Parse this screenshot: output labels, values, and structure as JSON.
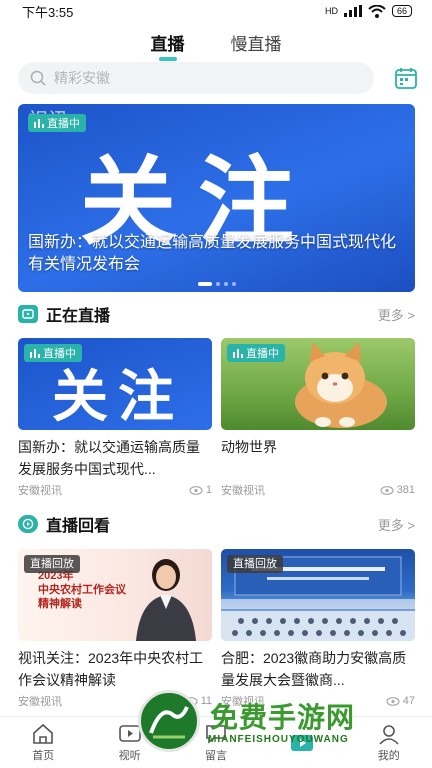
{
  "status": {
    "time": "下午3:55",
    "network": "HD",
    "battery": "66"
  },
  "tabs": [
    {
      "label": "直播"
    },
    {
      "label": "慢直播"
    }
  ],
  "search": {
    "placeholder": "精彩安徽"
  },
  "banner": {
    "big_text": "关注",
    "tag": "视讯",
    "badge": "直播中",
    "caption": "国新办：就以交通运输高质量发展服务中国式现代化有关情况发布会"
  },
  "live_section": {
    "title": "正在直播",
    "more": "更多",
    "cards": [
      {
        "badge": "直播中",
        "thumb_text": "关注",
        "title": "国新办：就以交通运输高质量发展服务中国式现代...",
        "source": "安徽视讯",
        "views": "1"
      },
      {
        "badge": "直播中",
        "title": "动物世界",
        "source": "安徽视讯",
        "views": "381"
      }
    ]
  },
  "replay_section": {
    "title": "直播回看",
    "more": "更多",
    "cards": [
      {
        "badge": "直播回放",
        "thumb_line1": "2023年",
        "thumb_line2": "中央农村工作会议",
        "thumb_line3": "精神解读",
        "title": "视讯关注：2023年中央农村工作会议精神解读",
        "source": "安徽视讯",
        "views": "11"
      },
      {
        "badge": "直播回放",
        "title": "合肥：2023徽商助力安徽高质量发展大会暨徽商...",
        "source": "安徽视讯",
        "views": "47"
      }
    ]
  },
  "watermark": {
    "text": "免费手游网",
    "sub": "MIANFEISHOUYOUWANG"
  },
  "nav": [
    {
      "label": "首页"
    },
    {
      "label": "视听"
    },
    {
      "label": "留言"
    },
    {
      "label": ""
    },
    {
      "label": "我的"
    }
  ],
  "colors": {
    "accent": "#2ab3a8",
    "tab_underline": "#36c7c0",
    "banner_blue": "#2d6fe8"
  }
}
